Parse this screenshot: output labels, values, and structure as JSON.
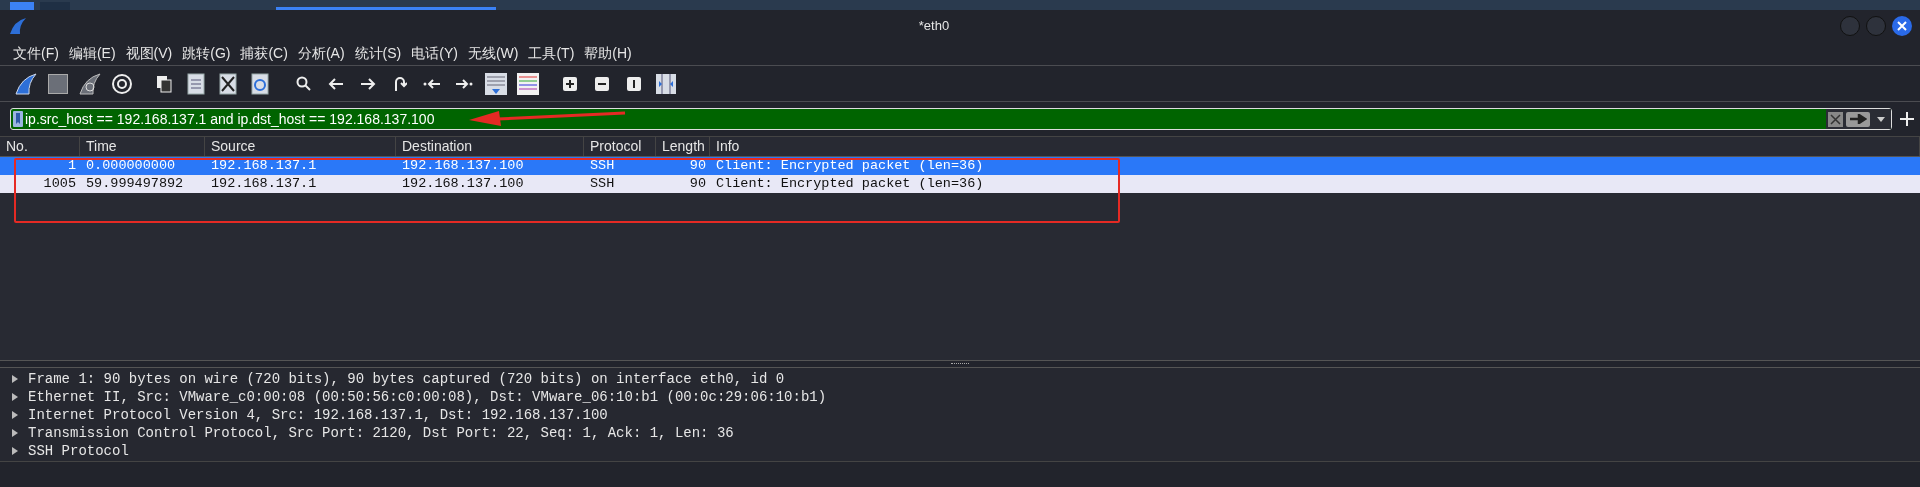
{
  "window": {
    "title": "*eth0"
  },
  "menu": [
    "文件(F)",
    "编辑(E)",
    "视图(V)",
    "跳转(G)",
    "捕获(C)",
    "分析(A)",
    "统计(S)",
    "电话(Y)",
    "无线(W)",
    "工具(T)",
    "帮助(H)"
  ],
  "filter": {
    "value": "ip.src_host == 192.168.137.1 and ip.dst_host == 192.168.137.100"
  },
  "table": {
    "columns": [
      "No.",
      "Time",
      "Source",
      "Destination",
      "Protocol",
      "Length",
      "Info"
    ],
    "rows": [
      {
        "selected": true,
        "cells": [
          "1",
          "0.000000000",
          "192.168.137.1",
          "192.168.137.100",
          "SSH",
          "90",
          "Client: Encrypted packet (len=36)"
        ]
      },
      {
        "selected": false,
        "cells": [
          "1005",
          "59.999497892",
          "192.168.137.1",
          "192.168.137.100",
          "SSH",
          "90",
          "Client: Encrypted packet (len=36)"
        ]
      }
    ]
  },
  "details": [
    {
      "text": "Frame 1: 90 bytes on wire (720 bits), 90 bytes captured (720 bits) on interface eth0, id 0",
      "expanded": false
    },
    {
      "text": "Ethernet II, Src: VMware_c0:00:08 (00:50:56:c0:00:08), Dst: VMware_06:10:b1 (00:0c:29:06:10:b1)",
      "expanded": false
    },
    {
      "text": "Internet Protocol Version 4, Src: 192.168.137.1, Dst: 192.168.137.100",
      "expanded": false
    },
    {
      "text": "Transmission Control Protocol, Src Port: 2120, Dst Port: 22, Seq: 1, Ack: 1, Len: 36",
      "expanded": false
    },
    {
      "text": "SSH Protocol",
      "expanded": false
    }
  ]
}
